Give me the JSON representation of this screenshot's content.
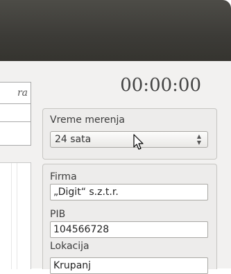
{
  "left_table": {
    "header_partial": "ra"
  },
  "timer": {
    "value": "00:00:00"
  },
  "measurement": {
    "label": "Vreme merenja",
    "selected": "24 sata"
  },
  "company": {
    "firma_label": "Firma",
    "firma_value": "„Digit“ s.z.t.r.",
    "pib_label": "PIB",
    "pib_value": "104566728",
    "lokacija_label": "Lokacija",
    "lokacija_value": "Krupanj"
  }
}
